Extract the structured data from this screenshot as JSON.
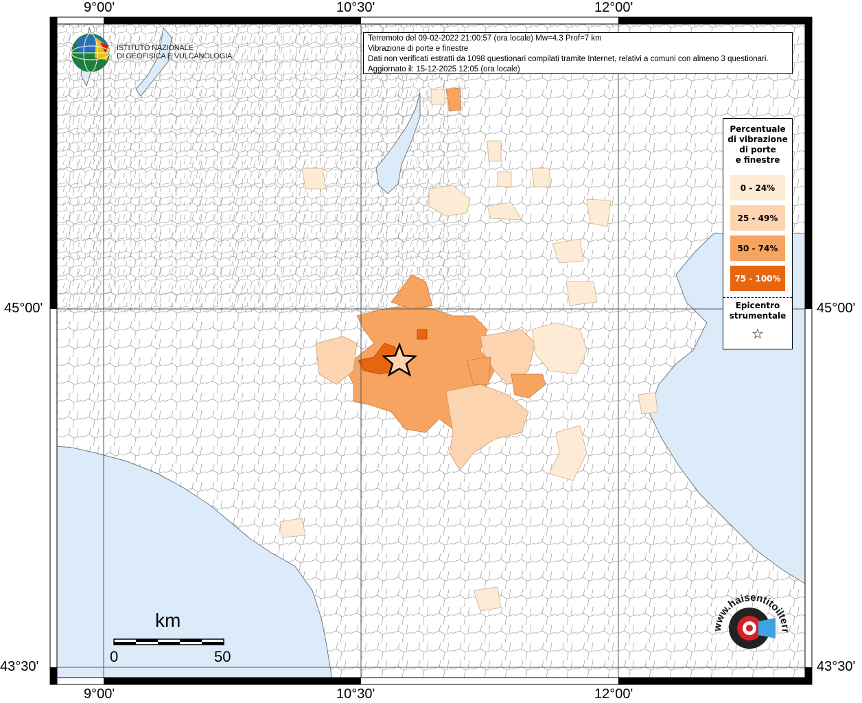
{
  "map": {
    "grid_labels": {
      "lon_top": [
        "9°00'",
        "10°30'",
        "12°00'"
      ],
      "lon_bottom": [
        "9°00'",
        "10°30'",
        "12°00'"
      ],
      "lat_left": [
        "45°00'",
        "43°30'"
      ],
      "lat_right": [
        "45°00'",
        "43°30'"
      ]
    },
    "info": {
      "line1": "Terremoto del 09-02-2022 21:00:57 (ora locale) Mw=4.3 Prof=7 km",
      "line2": "Vibrazione di porte e finestre",
      "line3": "Dati non verificati estratti da 1098 questionari compilati tramite Internet, relativi a comuni con almeno 3 questionari.",
      "line4": "Aggiornato il: 15-12-2025 12:05 (ora locale)"
    },
    "logo": {
      "line1": "ISTITUTO NAZIONALE",
      "line2": "DI GEOFISICA E VULCANOLOGIA"
    },
    "legend": {
      "title_lines": [
        "Percentuale",
        "di vibrazione",
        "di porte",
        "e finestre"
      ],
      "classes": [
        {
          "label": "0 - 24%",
          "color": "#fdebd5"
        },
        {
          "label": "25 - 49%",
          "color": "#fcd5b0"
        },
        {
          "label": "50 - 74%",
          "color": "#f6a460"
        },
        {
          "label": "75 - 100%",
          "color": "#e8650f"
        }
      ],
      "epicentre_lines": [
        "Epicentro",
        "strumentale"
      ],
      "star": "☆"
    },
    "scale": {
      "unit": "km",
      "start": "0",
      "end": "50"
    },
    "watermark": {
      "text": "www.haisentitoilterremoto.it",
      "icon": "target-icon"
    },
    "colors": {
      "sea": "#dcebfa",
      "land": "#ffffff",
      "border": "#888888"
    }
  }
}
